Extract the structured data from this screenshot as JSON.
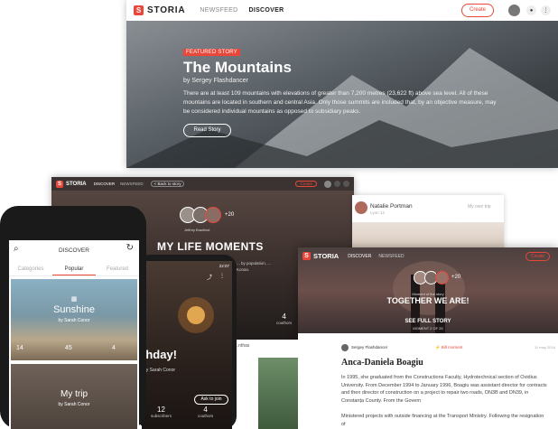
{
  "desktop_top": {
    "brand": "STORIA",
    "nav": [
      "NEWSFEED",
      "DISCOVER"
    ],
    "create_label": "Create",
    "hero": {
      "badge": "FEATURED STORY",
      "title": "The Mountains",
      "author": "by Sergey Flashdancer",
      "body": "There are at least 109 mountains with elevations of greater than 7,200 metres (23,622 ft) above sea level. All of these mountains are located in southern and central Asia. Only those summits are included that, by an objective measure, may be considered individual mountains as opposed to subsidiary peaks.",
      "cta": "Read Story"
    }
  },
  "desktop_mid": {
    "brand": "STORIA",
    "nav": [
      "DISCOVER",
      "NEWSFEED"
    ],
    "back": "< Back to story",
    "create_label": "Create",
    "avatar_count": "+20",
    "title": "MY LIFE MOMENTS",
    "author_small": "Jeffrey Bradford",
    "snippet": "... by population, ... Konan.",
    "stats": [
      {
        "value": "4",
        "label": "couthors"
      }
    ]
  },
  "comment_card": {
    "name": "Natalie Portman",
    "sub": "Lyon 12",
    "right": "My own trip"
  },
  "desktop_front": {
    "brand": "STORIA",
    "nav": [
      "DISCOVER",
      "NEWSFEED"
    ],
    "create_label": "Create",
    "avatar_count": "+20",
    "moment_label": "Moment of the story",
    "headline": "TOGETHER WE ARE!",
    "see_full": "SEE FULL STORY",
    "moment_index": "MOMENT 2 OF 25",
    "author_line": "Sergey Flashdancer",
    "author_tag": "⚡ Bill moment",
    "date": "11 may 2016",
    "person": "Anca-Daniela Boagiu",
    "para1": "In 1995, she graduated from the Constructions Faculty, Hydrotechnical section of Ovidius University. From December 1994 to January 1996, Boagiu was assistant director for contracts and then director of construction on a project to repair two roads, DN3B and DN39, in Constanța County. From the Govern",
    "para2": "Ministered projects with outside financing at the Transport Ministry. Following the resignation of"
  },
  "phone_left": {
    "header": "DISCOVER",
    "tabs": [
      "Categories",
      "Popular",
      "Featured"
    ],
    "cards": [
      {
        "title": "Sunshine",
        "author": "by Sarah Conor",
        "stats": [
          "14",
          "45",
          "4"
        ]
      },
      {
        "title": "My trip",
        "author": "by Sarah Conor"
      }
    ]
  },
  "phone_right": {
    "time": "22:07",
    "text": "thday!",
    "by": "by Sarah Conor",
    "ask": "Ask to join",
    "stats": [
      {
        "value": "12",
        "label": "subscribers"
      },
      {
        "value": "4",
        "label": "couthors"
      }
    ]
  },
  "lower_strip": {
    "label": "...nthas"
  },
  "colors": {
    "accent": "#e8473a",
    "nav_bg": "#ffffff",
    "dark_bg": "#2e2826"
  }
}
